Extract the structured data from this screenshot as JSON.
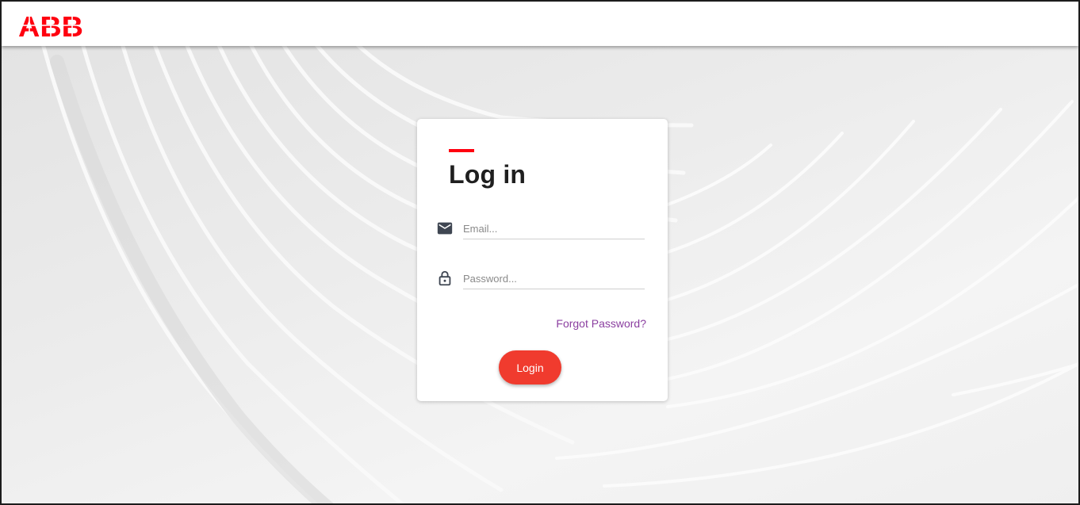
{
  "header": {
    "logo_text": "ABB",
    "brand_color": "#ff000f"
  },
  "login_card": {
    "title": "Log in",
    "accent_color": "#ff000f",
    "email": {
      "placeholder": "Email...",
      "value": "",
      "icon": "envelope-icon"
    },
    "password": {
      "placeholder": "Password...",
      "value": "",
      "icon": "lock-icon"
    },
    "forgot_password_label": "Forgot Password?",
    "login_button_label": "Login",
    "button_color": "#f03b2e",
    "link_color": "#8b3fa0"
  }
}
